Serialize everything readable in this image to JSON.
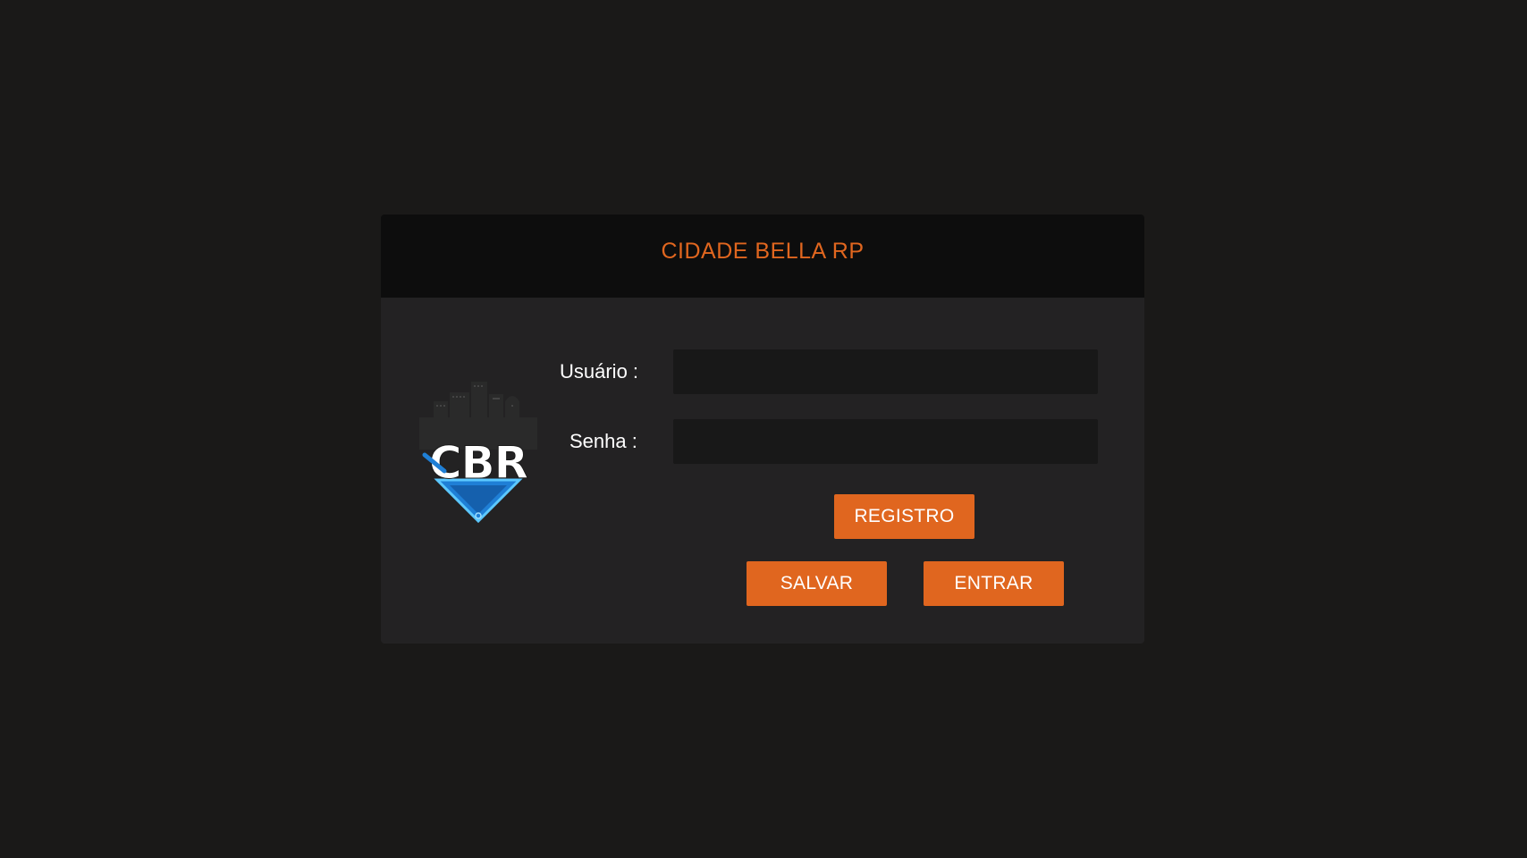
{
  "dialog": {
    "title": "CIDADE BELLA RP"
  },
  "logo": {
    "text": "CBR"
  },
  "form": {
    "user_label": "Usuário :",
    "user_value": "",
    "password_label": "Senha :",
    "password_value": ""
  },
  "buttons": {
    "register_label": "REGISTRO",
    "save_label": "SALVAR",
    "enter_label": "ENTRAR"
  },
  "colors": {
    "background": "#1a1918",
    "panel": "#232223",
    "header": "#0d0d0d",
    "accent": "#e0661f",
    "input": "#181818",
    "logo_blue": "#1f7fd6"
  }
}
